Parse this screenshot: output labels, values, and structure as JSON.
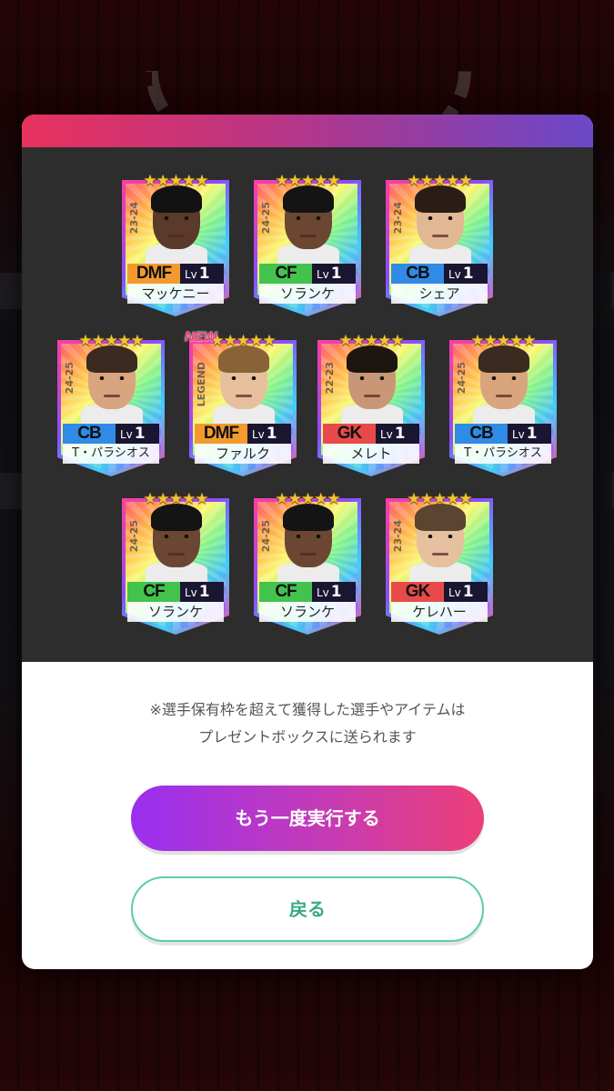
{
  "stars": "★★★★★",
  "new_badge": "NEW",
  "cards": [
    {
      "pos": "DMF",
      "lv_label": "Lv",
      "lv": "1",
      "name": "マッケニー",
      "season": "23-24"
    },
    {
      "pos": "CF",
      "lv_label": "Lv",
      "lv": "1",
      "name": "ソランケ",
      "season": "24-25"
    },
    {
      "pos": "CB",
      "lv_label": "Lv",
      "lv": "1",
      "name": "シェア",
      "season": "23-24"
    },
    {
      "pos": "CB",
      "lv_label": "Lv",
      "lv": "1",
      "name": "T・パラシオス",
      "season": "24-25"
    },
    {
      "pos": "DMF",
      "lv_label": "Lv",
      "lv": "1",
      "name": "ファルク",
      "season": "LEGEND"
    },
    {
      "pos": "GK",
      "lv_label": "Lv",
      "lv": "1",
      "name": "メレト",
      "season": "22-23"
    },
    {
      "pos": "CB",
      "lv_label": "Lv",
      "lv": "1",
      "name": "T・パラシオス",
      "season": "24-25"
    },
    {
      "pos": "CF",
      "lv_label": "Lv",
      "lv": "1",
      "name": "ソランケ",
      "season": "24-25"
    },
    {
      "pos": "CF",
      "lv_label": "Lv",
      "lv": "1",
      "name": "ソランケ",
      "season": "24-25"
    },
    {
      "pos": "GK",
      "lv_label": "Lv",
      "lv": "1",
      "name": "ケレハー",
      "season": "23-24"
    }
  ],
  "notice_line1": "※選手保有枠を超えて獲得した選手やアイテムは",
  "notice_line2": "プレゼントボックスに送られます",
  "retry_button": "もう一度実行する",
  "back_button": "戻る",
  "colors": {
    "accent_pink": "#ec3f77",
    "accent_purple": "#9a2ff0",
    "back_green": "#3aa983"
  }
}
